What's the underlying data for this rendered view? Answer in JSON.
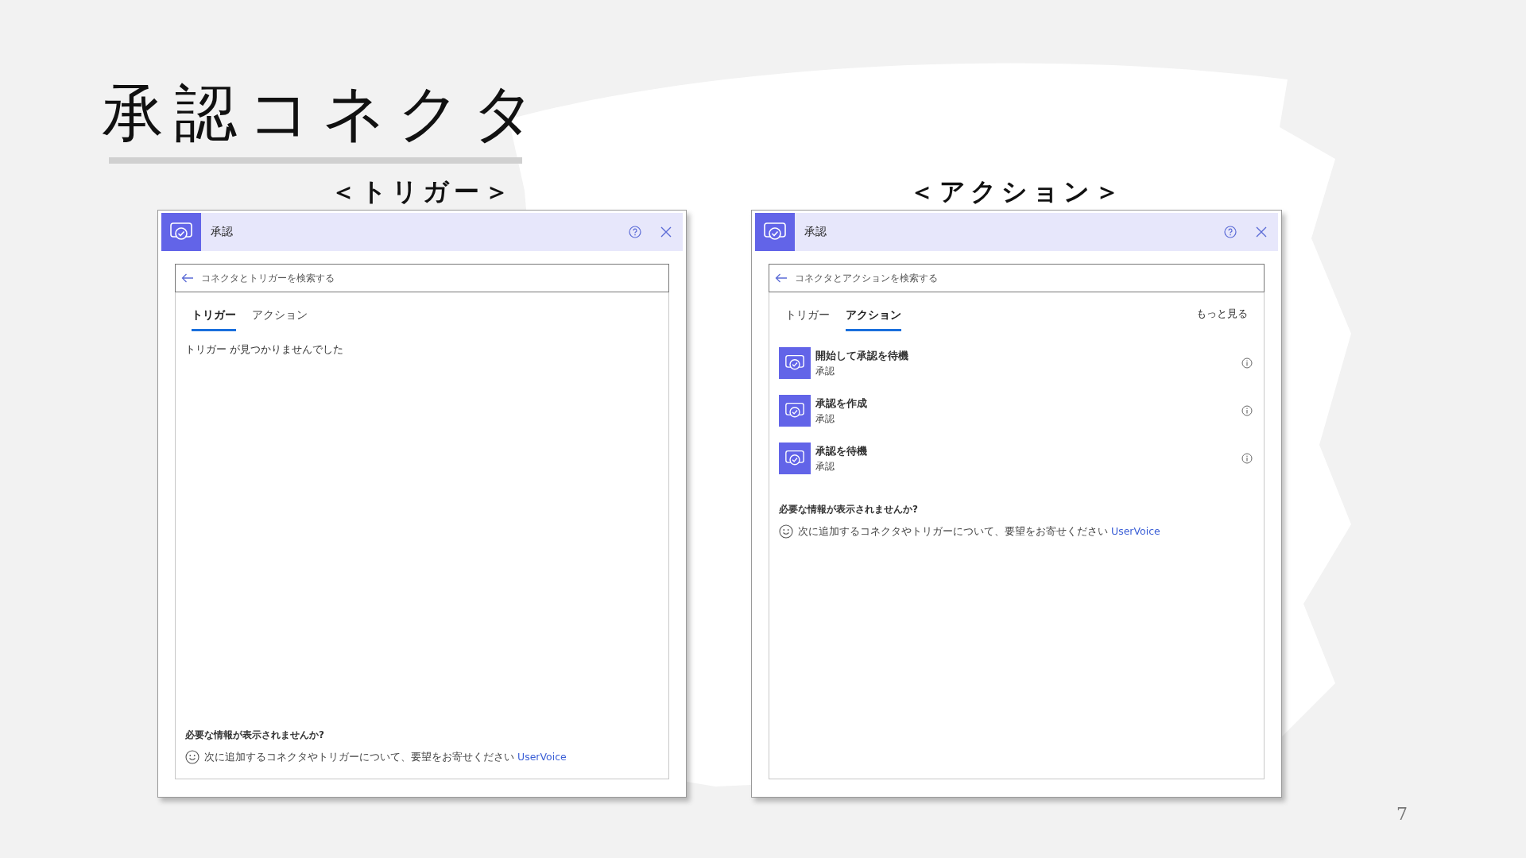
{
  "slide": {
    "title": "承認コネクタ",
    "page_number": "7"
  },
  "panels": [
    {
      "kind": "empty",
      "caption": "＜トリガー＞",
      "header_title": "承認",
      "search": {
        "placeholder": "コネクタとトリガーを検索する"
      },
      "tabs": [
        {
          "label": "トリガー",
          "selected": true
        },
        {
          "label": "アクション",
          "selected": false
        }
      ],
      "message": "トリガー が見つかりませんでした",
      "feedback": {
        "heading": "必要な情報が表示されませんか?",
        "text": "次に追加するコネクタやトリガーについて、要望をお寄せください",
        "link": "UserVoice"
      }
    },
    {
      "kind": "results",
      "caption": "＜アクション＞",
      "header_title": "承認",
      "search": {
        "placeholder": "コネクタとアクションを検索する"
      },
      "tabs": [
        {
          "label": "トリガー",
          "selected": false
        },
        {
          "label": "アクション",
          "selected": true
        }
      ],
      "more_link": "もっと見る",
      "items": [
        {
          "title": "開始して承認を待機",
          "subtitle": "承認"
        },
        {
          "title": "承認を作成",
          "subtitle": "承認"
        },
        {
          "title": "承認を待機",
          "subtitle": "承認"
        }
      ],
      "feedback": {
        "heading": "必要な情報が表示されませんか?",
        "text": "次に追加するコネクタやトリガーについて、要望をお寄せください",
        "link": "UserVoice"
      }
    }
  ]
}
